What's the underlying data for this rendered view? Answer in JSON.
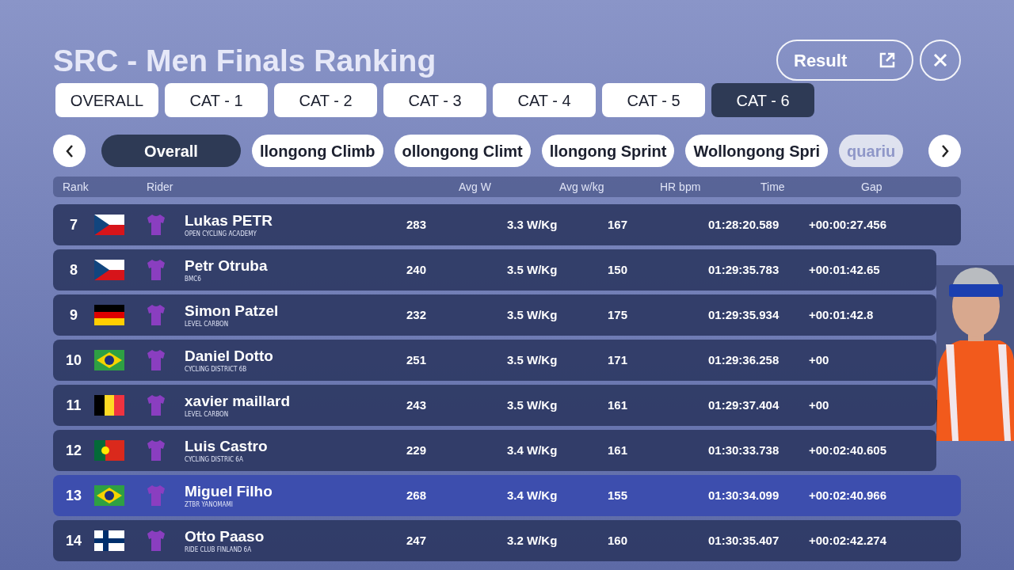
{
  "title": "SRC - Men Finals Ranking",
  "result_button": "Result",
  "category_tabs": [
    {
      "label": "OVERALL",
      "selected": false
    },
    {
      "label": "CAT - 1",
      "selected": false
    },
    {
      "label": "CAT - 2",
      "selected": false
    },
    {
      "label": "CAT - 3",
      "selected": false
    },
    {
      "label": "CAT - 4",
      "selected": false
    },
    {
      "label": "CAT - 5",
      "selected": false
    },
    {
      "label": "CAT - 6",
      "selected": true
    }
  ],
  "stage_tabs": [
    {
      "label": "Overall",
      "selected": true,
      "faded": false
    },
    {
      "label": "llongong Climb",
      "selected": false,
      "faded": false
    },
    {
      "label": "ollongong Climt",
      "selected": false,
      "faded": false
    },
    {
      "label": "llongong Sprint",
      "selected": false,
      "faded": false
    },
    {
      "label": "Wollongong Spri",
      "selected": false,
      "faded": false
    },
    {
      "label": "quariu",
      "selected": false,
      "faded": true
    }
  ],
  "table": {
    "columns": [
      "Rank",
      "Rider",
      "Avg W",
      "Avg w/kg",
      "HR bpm",
      "Time",
      "Gap"
    ],
    "rows": [
      {
        "rank": "7",
        "flag": {
          "kind": "cz"
        },
        "name": "Lukas PETR",
        "team": "OPEN CYCLING ACADEMY",
        "avg_w": "283",
        "avg_wkg": "3.3 W/Kg",
        "hr": "167",
        "time": "01:28:20.589",
        "gap": "+00:00:27.456",
        "selected": false
      },
      {
        "rank": "8",
        "flag": {
          "kind": "cz"
        },
        "name": "Petr Otruba",
        "team": "BMC6",
        "avg_w": "240",
        "avg_wkg": "3.5 W/Kg",
        "hr": "150",
        "time": "01:29:35.783",
        "gap": "+00:01:42.65",
        "selected": false
      },
      {
        "rank": "9",
        "flag": {
          "kind": "de"
        },
        "name": "Simon Patzel",
        "team": "LEVEL CARBON",
        "avg_w": "232",
        "avg_wkg": "3.5 W/Kg",
        "hr": "175",
        "time": "01:29:35.934",
        "gap": "+00:01:42.8",
        "selected": false
      },
      {
        "rank": "10",
        "flag": {
          "kind": "br"
        },
        "name": "Daniel Dotto",
        "team": "CYCLING DISTRICT 6B",
        "avg_w": "251",
        "avg_wkg": "3.5 W/Kg",
        "hr": "171",
        "time": "01:29:36.258",
        "gap": "+00",
        "selected": false
      },
      {
        "rank": "11",
        "flag": {
          "kind": "be"
        },
        "name": "xavier maillard",
        "team": "LEVEL CARBON",
        "avg_w": "243",
        "avg_wkg": "3.5 W/Kg",
        "hr": "161",
        "time": "01:29:37.404",
        "gap": "+00",
        "selected": false
      },
      {
        "rank": "12",
        "flag": {
          "kind": "pt"
        },
        "name": "Luis Castro",
        "team": "CYCLING DISTRIC 6A",
        "avg_w": "229",
        "avg_wkg": "3.4 W/Kg",
        "hr": "161",
        "time": "01:30:33.738",
        "gap": "+00:02:40.605",
        "selected": false
      },
      {
        "rank": "13",
        "flag": {
          "kind": "br"
        },
        "name": "Miguel Filho",
        "team": "ZTBR YANOMAMI",
        "avg_w": "268",
        "avg_wkg": "3.4 W/Kg",
        "hr": "155",
        "time": "01:30:34.099",
        "gap": "+00:02:40.966",
        "selected": true
      },
      {
        "rank": "14",
        "flag": {
          "kind": "fi"
        },
        "name": "Otto Paaso",
        "team": "RIDE CLUB FINLAND 6A",
        "avg_w": "247",
        "avg_wkg": "3.2 W/Kg",
        "hr": "160",
        "time": "01:30:35.407",
        "gap": "+00:02:42.274",
        "selected": false
      }
    ]
  }
}
